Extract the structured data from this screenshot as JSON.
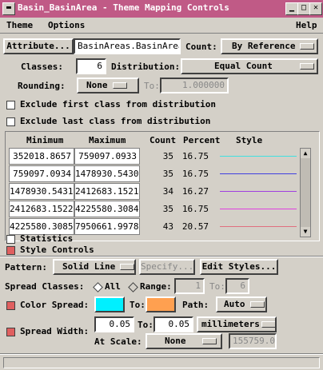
{
  "window": {
    "title": "Basin_BasinArea - Theme Mapping Controls"
  },
  "menu": {
    "theme": "Theme",
    "options": "Options",
    "help": "Help"
  },
  "attribute": {
    "button": "Attribute...",
    "value": "BasinAreas.BasinArea",
    "count_label": "Count:",
    "count_value": "By Reference"
  },
  "classes": {
    "label": "Classes:",
    "value": "6",
    "distribution_label": "Distribution:",
    "distribution_value": "Equal Count"
  },
  "rounding": {
    "label": "Rounding:",
    "value": "None",
    "to_label": "To:",
    "to_value": "1.000000"
  },
  "exclude": {
    "first": "Exclude first class from distribution",
    "last": "Exclude last class from distribution"
  },
  "table": {
    "headers": [
      "Minimum",
      "Maximum",
      "Count",
      "Percent",
      "Style"
    ],
    "rows": [
      {
        "min": "352018.8657",
        "max": "759097.0933",
        "count": "35",
        "percent": "16.75",
        "color": "#40e0e0"
      },
      {
        "min": "759097.0934",
        "max": "1478930.5430",
        "count": "35",
        "percent": "16.75",
        "color": "#4040e0"
      },
      {
        "min": "1478930.5431",
        "max": "2412683.1521",
        "count": "34",
        "percent": "16.27",
        "color": "#a040e0"
      },
      {
        "min": "2412683.1522",
        "max": "4225580.3084",
        "count": "35",
        "percent": "16.75",
        "color": "#e040e0"
      },
      {
        "min": "4225580.3085",
        "max": "7950661.9978",
        "count": "43",
        "percent": "20.57",
        "color": "#e07080"
      }
    ]
  },
  "toggles": {
    "statistics": "Statistics",
    "style_controls": "Style Controls"
  },
  "pattern": {
    "label": "Pattern:",
    "value": "Solid Line",
    "specify": "Specify...",
    "edit": "Edit Styles..."
  },
  "spread": {
    "label": "Spread Classes:",
    "all": "All",
    "range": "Range:",
    "range_from": "1",
    "to_label": "To:",
    "range_to": "6"
  },
  "color_spread": {
    "label": "Color Spread:",
    "from_color": "#00f0ff",
    "to_label": "To:",
    "to_color": "#ffa050",
    "path_label": "Path:",
    "path_value": "Auto"
  },
  "spread_width": {
    "label": "Spread Width:",
    "from": "0.05",
    "to_label": "To:",
    "to": "0.05",
    "units": "millimeters",
    "scale_label": "At Scale:",
    "scale_value": "None",
    "scale_number": "155759.0"
  }
}
